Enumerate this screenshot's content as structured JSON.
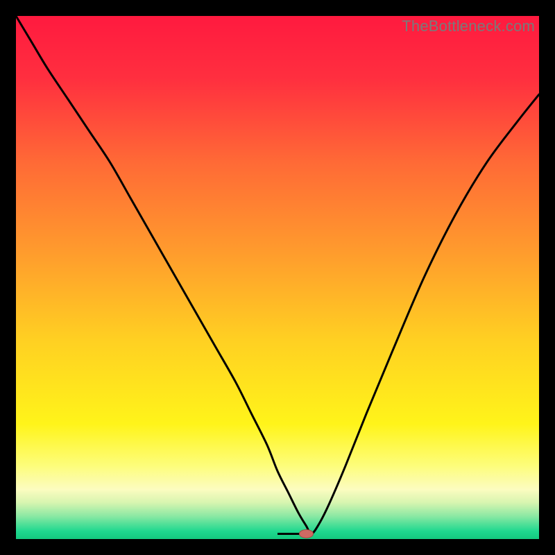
{
  "watermark": "TheBottleneck.com",
  "chart_data": {
    "type": "line",
    "title": "",
    "xlabel": "",
    "ylabel": "",
    "xlim": [
      0,
      100
    ],
    "ylim": [
      0,
      100
    ],
    "grid": false,
    "legend": false,
    "background_gradient": {
      "stops": [
        {
          "offset": 0.0,
          "color": "#ff1a3f"
        },
        {
          "offset": 0.12,
          "color": "#ff2f3f"
        },
        {
          "offset": 0.28,
          "color": "#ff6a36"
        },
        {
          "offset": 0.45,
          "color": "#ff9b2d"
        },
        {
          "offset": 0.62,
          "color": "#ffd022"
        },
        {
          "offset": 0.78,
          "color": "#fff41a"
        },
        {
          "offset": 0.86,
          "color": "#fdfd7b"
        },
        {
          "offset": 0.905,
          "color": "#fcfcc0"
        },
        {
          "offset": 0.93,
          "color": "#d8f5b0"
        },
        {
          "offset": 0.955,
          "color": "#8fe9a4"
        },
        {
          "offset": 0.985,
          "color": "#1fd88f"
        },
        {
          "offset": 1.0,
          "color": "#14c97f"
        }
      ]
    },
    "series": [
      {
        "name": "bottleneck-curve",
        "color": "#000000",
        "width": 3,
        "x": [
          0,
          3,
          6,
          10,
          14,
          18,
          22,
          26,
          30,
          34,
          38,
          42,
          45,
          48,
          50,
          52,
          54,
          55.5,
          56.5,
          58,
          60,
          63,
          67,
          72,
          78,
          84,
          90,
          96,
          100
        ],
        "y": [
          100,
          95,
          90,
          84,
          78,
          72,
          65,
          58,
          51,
          44,
          37,
          30,
          24,
          18,
          13,
          9,
          5,
          2.5,
          1.0,
          3,
          7,
          14,
          24,
          36,
          50,
          62,
          72,
          80,
          85
        ]
      }
    ],
    "flat_segment": {
      "x0": 50,
      "x1": 56.5,
      "y": 1.0
    },
    "marker": {
      "name": "optimal-point",
      "x": 55.5,
      "y": 1.0,
      "rx": 10,
      "ry": 6,
      "fill": "#cf6a63",
      "stroke": "#a24c45"
    }
  }
}
